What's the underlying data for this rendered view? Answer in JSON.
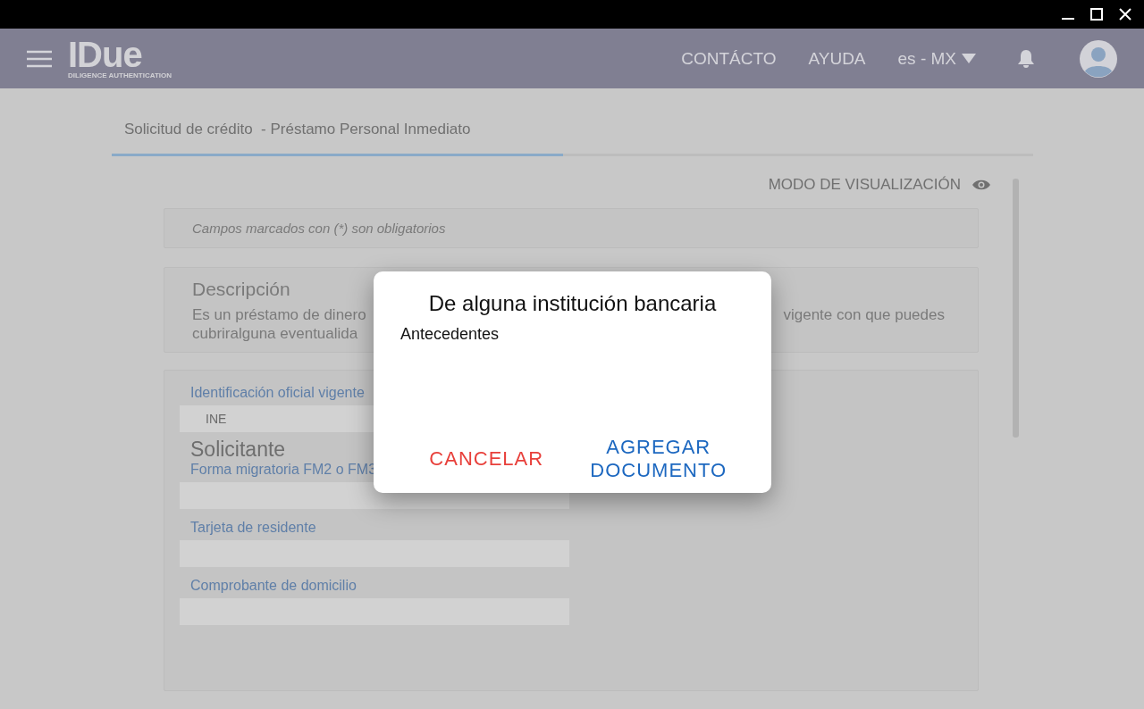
{
  "header": {
    "logo": "IDue",
    "logo_tagline": "DILIGENCE AUTHENTICATION",
    "nav": [
      "CONTÁCTO",
      "AYUDA"
    ],
    "language": "es - MX"
  },
  "tab": {
    "title": "Solicitud de crédito  - Préstamo Personal Inmediato",
    "level": 0.49
  },
  "view_mode": "MODO DE VISUALIZACIÓN",
  "notice": "Campos marcados con (*) son obligatorios",
  "description": {
    "title": "Descripción",
    "left_lines": [
      "Es un préstamo de dinero",
      "cubriralguna eventualida"
    ],
    "right_line": "vigente con que puedes"
  },
  "form": {
    "first_field": {
      "label": "Identificación oficial vigente",
      "value": "INE"
    },
    "section": "Solicitante",
    "fields": [
      {
        "label": "Forma migratoria FM2 o FM3"
      },
      {
        "label": "Tarjeta de residente"
      },
      {
        "label": "Comprobante de domicilio"
      }
    ]
  },
  "dialog": {
    "title": "De alguna institución bancaria",
    "body": "Antecedentes",
    "buttons": [
      {
        "label": "CANCELAR",
        "kind": "cancel"
      },
      {
        "label": "AGREGAR DOCUMENTO",
        "kind": "confirm"
      }
    ]
  }
}
